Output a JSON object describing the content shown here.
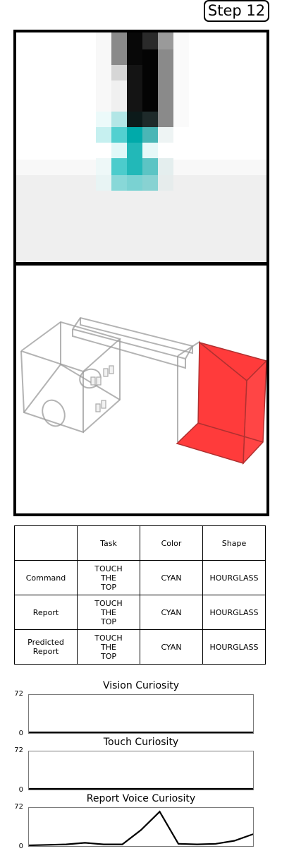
{
  "step_label": "Step 12",
  "table": {
    "header": [
      "",
      "Task",
      "Color",
      "Shape"
    ],
    "rows": [
      {
        "label": "Command",
        "task": "TOUCH\nTHE\nTOP",
        "color": "CYAN",
        "shape": "HOURGLASS"
      },
      {
        "label": "Report",
        "task": "TOUCH\nTHE\nTOP",
        "color": "CYAN",
        "shape": "HOURGLASS"
      },
      {
        "label": "Predicted\nReport",
        "task": "TOUCH\nTHE\nTOP",
        "color": "CYAN",
        "shape": "HOURGLASS"
      }
    ]
  },
  "chart_data": [
    {
      "type": "line",
      "title": "Vision Curiosity",
      "ylim": [
        0,
        72
      ],
      "yticks": [
        "72",
        "0"
      ],
      "x": [
        0,
        1,
        2,
        3,
        4,
        5,
        6,
        7,
        8,
        9,
        10,
        11,
        12
      ],
      "values": [
        0,
        0,
        0,
        0,
        0,
        0,
        0,
        0,
        0,
        0,
        0,
        0,
        0
      ],
      "color": "#000000"
    },
    {
      "type": "line",
      "title": "Touch Curiosity",
      "ylim": [
        0,
        72
      ],
      "yticks": [
        "72",
        "0"
      ],
      "x": [
        0,
        1,
        2,
        3,
        4,
        5,
        6,
        7,
        8,
        9,
        10,
        11,
        12
      ],
      "values": [
        0,
        0,
        0,
        0,
        0,
        0,
        0,
        0,
        0,
        0,
        0,
        0,
        0
      ],
      "color": "#000000"
    },
    {
      "type": "line",
      "title": "Report Voice Curiosity",
      "ylim": [
        0,
        72
      ],
      "yticks": [
        "72",
        "0"
      ],
      "x": [
        0,
        1,
        2,
        3,
        4,
        5,
        6,
        7,
        8,
        9,
        10,
        11,
        12
      ],
      "values": [
        0,
        1,
        2,
        5,
        2,
        2,
        30,
        66,
        3,
        2,
        3,
        9,
        22
      ],
      "color": "#000000"
    }
  ]
}
